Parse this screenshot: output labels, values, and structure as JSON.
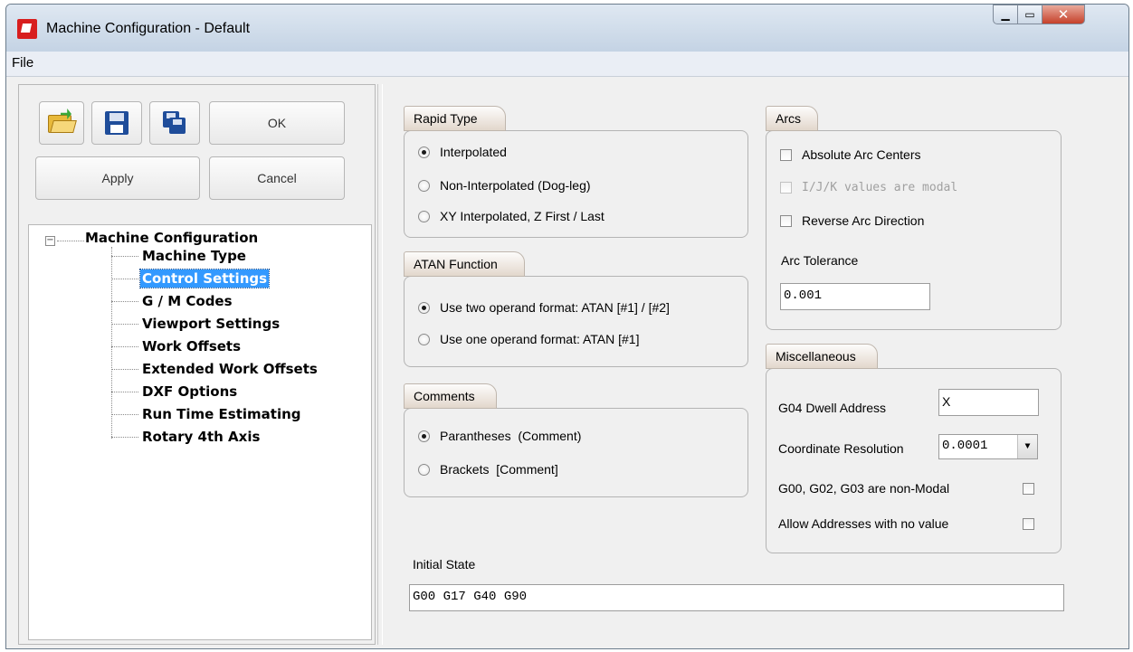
{
  "window": {
    "title": "Machine Configuration - Default"
  },
  "menu": {
    "file": "File"
  },
  "toolbar": {
    "open_icon": "open-folder-icon",
    "save_icon": "save-disk-icon",
    "save_as_icon": "save-as-disk-icon",
    "ok_label": "OK",
    "apply_label": "Apply",
    "cancel_label": "Cancel"
  },
  "tree": {
    "root": "Machine Configuration",
    "items": [
      {
        "label": "Machine Type"
      },
      {
        "label": "Control Settings",
        "selected": true
      },
      {
        "label": "G / M Codes"
      },
      {
        "label": "Viewport Settings"
      },
      {
        "label": "Work Offsets"
      },
      {
        "label": "Extended Work Offsets"
      },
      {
        "label": "DXF Options"
      },
      {
        "label": "Run Time Estimating"
      },
      {
        "label": "Rotary 4th Axis"
      }
    ]
  },
  "rapid_type": {
    "title": "Rapid Type",
    "options": [
      "Interpolated",
      "Non-Interpolated (Dog-leg)",
      "XY Interpolated, Z First / Last"
    ],
    "selected": 0
  },
  "atan_function": {
    "title": "ATAN Function",
    "options": [
      "Use two operand format: ATAN [#1] / [#2]",
      "Use one operand format: ATAN [#1]"
    ],
    "selected": 0
  },
  "comments": {
    "title": "Comments",
    "options": [
      "Parantheses  (Comment)",
      "Brackets  [Comment]"
    ],
    "selected": 0
  },
  "arcs": {
    "title": "Arcs",
    "absolute_arc_centers": "Absolute Arc Centers",
    "ijk_modal": "I/J/K values are modal",
    "reverse_arc_direction": "Reverse Arc Direction",
    "arc_tolerance_label": "Arc Tolerance",
    "arc_tolerance_value": "0.001"
  },
  "misc": {
    "title": "Miscellaneous",
    "g04_label": "G04 Dwell Address",
    "g04_value": "X",
    "coord_res_label": "Coordinate Resolution",
    "coord_res_value": "0.0001",
    "non_modal_label": "G00, G02, G03 are non-Modal",
    "allow_addresses_label": "Allow Addresses with no value"
  },
  "initial_state": {
    "label": "Initial State",
    "value": "G00 G17 G40 G90"
  }
}
